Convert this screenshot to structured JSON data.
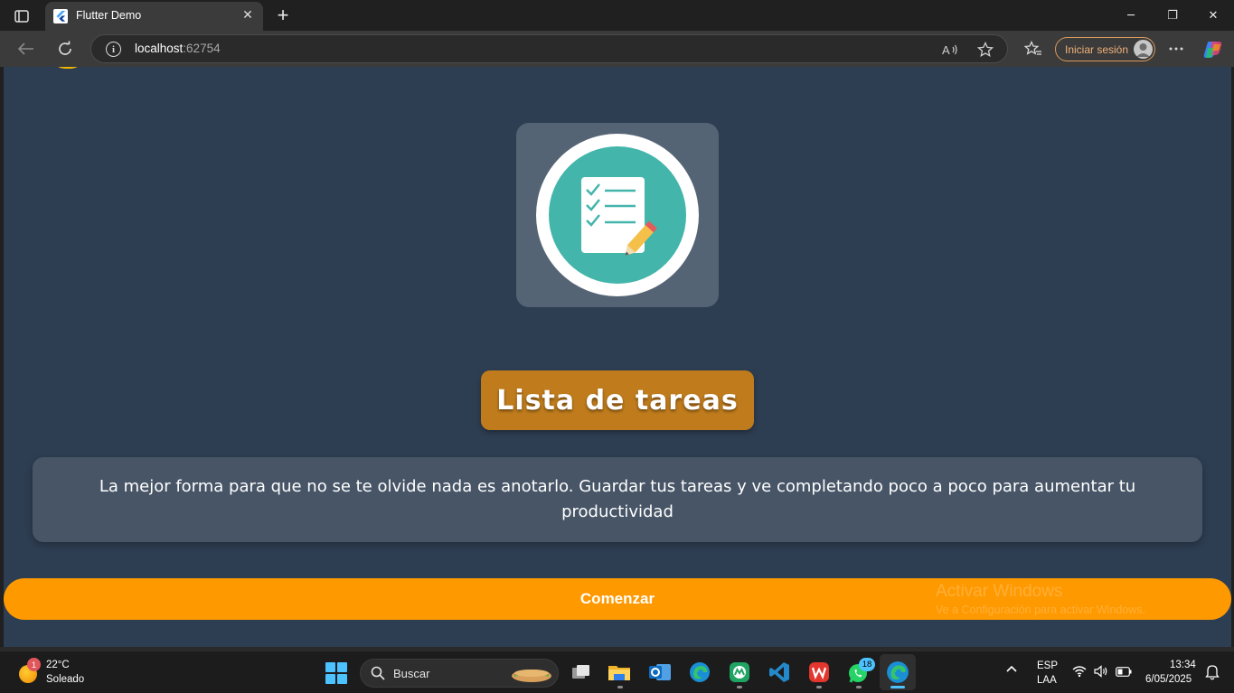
{
  "browser": {
    "tab_title": "Flutter Demo",
    "tab_close": "✕",
    "new_tab": "+",
    "url_host": "localhost",
    "url_port": ":62754",
    "signin_label": "Iniciar sesión",
    "window_controls": {
      "minimize": "─",
      "restore": "❐",
      "close": "✕"
    }
  },
  "page": {
    "title": "Lista de tareas",
    "description": "La mejor forma para que no se te olvide nada es anotarlo. Guardar tus tareas y ve completando poco a poco para aumentar tu productividad",
    "start_button": "Comenzar",
    "accent_color": "#ff9900",
    "background_color": "#2e3e52",
    "title_badge_color": "#c07c1c",
    "icon": "checklist-pencil-icon"
  },
  "watermark": {
    "title": "Activar Windows",
    "subtitle": "Ve a Configuración para activar Windows."
  },
  "taskbar": {
    "weather_badge": "1",
    "temperature": "22°C",
    "condition": "Soleado",
    "search_label": "Buscar",
    "whatsapp_badge": "18",
    "language": "ESP",
    "keyboard": "LAA",
    "time": "13:34",
    "date": "6/05/2025"
  }
}
